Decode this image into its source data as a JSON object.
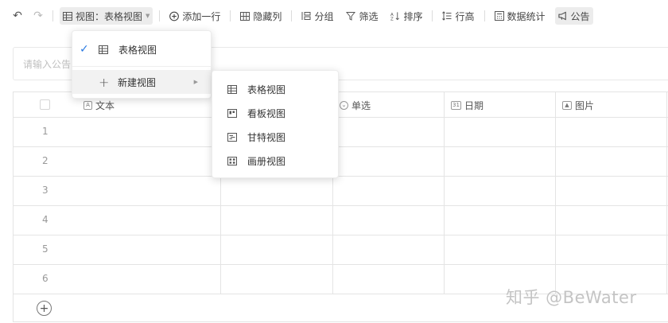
{
  "toolbar": {
    "view_label": "视图：表格视图",
    "add_row": "添加一行",
    "hide_columns": "隐藏列",
    "group": "分组",
    "filter": "筛选",
    "sort": "排序",
    "row_height": "行高",
    "stats": "数据统计",
    "announcement": "公告"
  },
  "notice": {
    "placeholder": "请输入公告"
  },
  "grid": {
    "columns": [
      {
        "label": "文本",
        "icon": "A"
      },
      {
        "label": "单选",
        "icon": "⌄"
      },
      {
        "label": "日期",
        "icon": "31"
      },
      {
        "label": "图片",
        "icon": "▲"
      }
    ],
    "row_numbers": [
      "1",
      "2",
      "3",
      "4",
      "5",
      "6"
    ]
  },
  "view_menu": {
    "current": "表格视图",
    "new_view": "新建视图"
  },
  "new_view_submenu": {
    "items": [
      {
        "label": "表格视图",
        "icon": "table-icon"
      },
      {
        "label": "看板视图",
        "icon": "kanban-icon"
      },
      {
        "label": "甘特视图",
        "icon": "gantt-icon"
      },
      {
        "label": "画册视图",
        "icon": "gallery-icon"
      }
    ]
  },
  "watermark": "知乎 @BeWater",
  "colors": {
    "accent": "#2a7ae2",
    "border": "#e4e4e4"
  }
}
